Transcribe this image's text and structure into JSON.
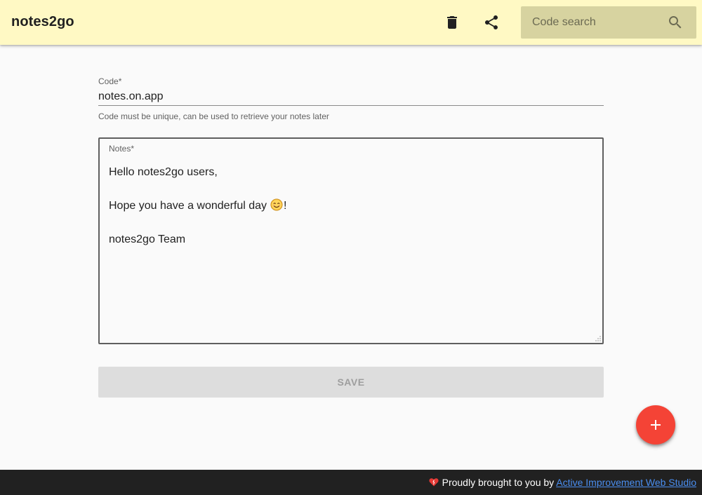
{
  "header": {
    "title": "notes2go",
    "background": "#fff9c4",
    "actions": [
      {
        "name": "delete",
        "icon": "trash-icon"
      },
      {
        "name": "share",
        "icon": "share-icon"
      }
    ],
    "search": {
      "placeholder": "Code search",
      "value": "",
      "icon": "search-icon"
    }
  },
  "form": {
    "code": {
      "label": "Code*",
      "value": "notes.on.app",
      "helper": "Code must be unique, can be used to retrieve your notes later"
    },
    "notes": {
      "label": "Notes*",
      "lines": [
        "Hello notes2go users,",
        "",
        "Hope you have a wonderful day",
        "!",
        "",
        "notes2go Team"
      ],
      "emoji_icon": "smiling-face-emoji-icon"
    },
    "save_label": "Save"
  },
  "fab": {
    "icon": "plus-icon",
    "color": "#f44336"
  },
  "footer": {
    "text": "Proudly brought to you by",
    "link_text": "Active Improvement Web Studio",
    "icon": "heart-icon",
    "link_color": "#4a8ef0"
  }
}
